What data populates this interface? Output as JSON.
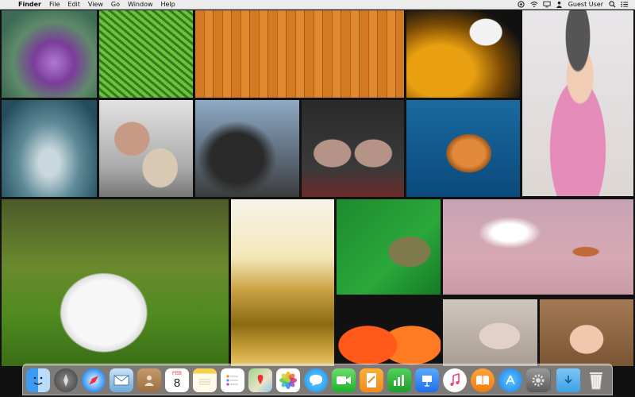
{
  "menubar": {
    "apple_glyph": "",
    "app_name": "Finder",
    "menus": [
      "File",
      "Edit",
      "View",
      "Go",
      "Window",
      "Help"
    ],
    "user": "Guest User",
    "status_icons": [
      "control-center-icon",
      "wifi-icon",
      "display-icon",
      "fast-user-switching-icon",
      "spotlight-icon",
      "notification-center-icon"
    ]
  },
  "wallpaper_tiles": [
    "purple-cabbage",
    "green-fern",
    "orange-wood-planks",
    "yellow-capsules",
    "girl-in-beret",
    "cloudy-sky-teal",
    "pottery-wheel-hands",
    "dark-storm-clouds",
    "tattooed-hands-rings",
    "sea-turtle",
    "white-puppy-in-grass",
    "golden-wheat-field",
    "green-insect-closeup",
    "bird-and-berries",
    "orange-halves",
    "clay-hands",
    "girl-portrait"
  ],
  "dock": {
    "calendar_month": "FEB",
    "calendar_day": "8",
    "apps": [
      "Finder",
      "Launchpad",
      "Safari",
      "Mail",
      "Contacts",
      "Calendar",
      "Notes",
      "Reminders",
      "Maps",
      "Photos",
      "Messages",
      "FaceTime",
      "Pages",
      "Numbers",
      "Keynote",
      "iTunes",
      "iBooks",
      "App Store",
      "System Preferences",
      "Downloads",
      "Trash"
    ]
  },
  "colors": {
    "menubar_bg": "#ececec",
    "dock_bg": "#d7d2cd"
  }
}
